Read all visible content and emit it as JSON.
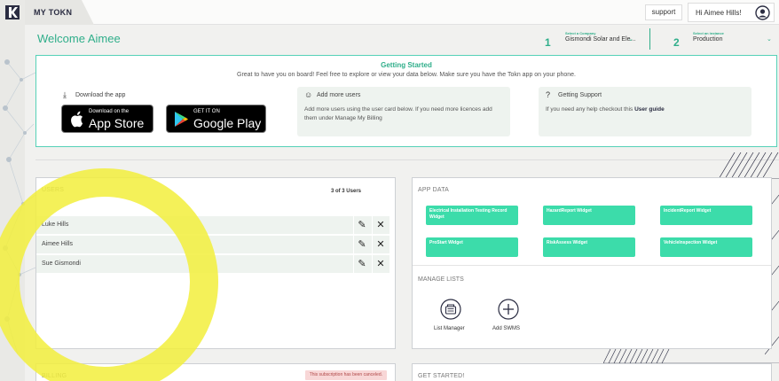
{
  "app": {
    "name": "MY TOKN"
  },
  "topbar": {
    "support_label": "support",
    "greeting": "Hi Aimee Hills!"
  },
  "welcome": "Welcome Aimee",
  "company_select": {
    "step": "1",
    "caption": "Select a Company",
    "value": "Gismondi Solar and Ele..."
  },
  "instance_select": {
    "step": "2",
    "caption": "Select an instance",
    "value": "Production"
  },
  "getting_started": {
    "title": "Getting Started",
    "subtitle": "Great to have you on board! Feel free to explore or view your data below. Make sure you have the Tokn app on your phone.",
    "download": {
      "title": "Download the app",
      "app_store_small": "Download on the",
      "app_store_big": "App Store",
      "play_small": "GET IT ON",
      "play_big": "Google Play"
    },
    "add_users": {
      "title": "Add more users",
      "body": "Add more users using the user card below. If you need more licences add them under Manage My Billing"
    },
    "support": {
      "title": "Getting Support",
      "body": "If you need any help checkout this",
      "link": "User guide"
    }
  },
  "users": {
    "title": "USERS",
    "count": "3 of 3 Users",
    "rows": [
      {
        "name": "Luke Hills"
      },
      {
        "name": "Aimee Hills"
      },
      {
        "name": "Sue Gismondi"
      }
    ]
  },
  "app_data": {
    "title": "APP DATA",
    "widgets": [
      "Electrical Installation Testing Record Widget",
      "HazardReport Widget",
      "IncidentReport Widget",
      "ProStart Widget",
      "RiskAssess Widget",
      "VehicleInspection Widget"
    ]
  },
  "manage_lists": {
    "title": "MANAGE LISTS",
    "list_manager": "List Manager",
    "add_swms": "Add SWMS"
  },
  "billing": {
    "title": "BILLING",
    "status": "This subscription has been canceled."
  },
  "get_started": {
    "title": "GET STARTED!"
  },
  "colors": {
    "accent": "#2fae8a",
    "widget": "#3cdcaa",
    "highlight": "#f2ee3c",
    "brand": "#2b2d42"
  }
}
